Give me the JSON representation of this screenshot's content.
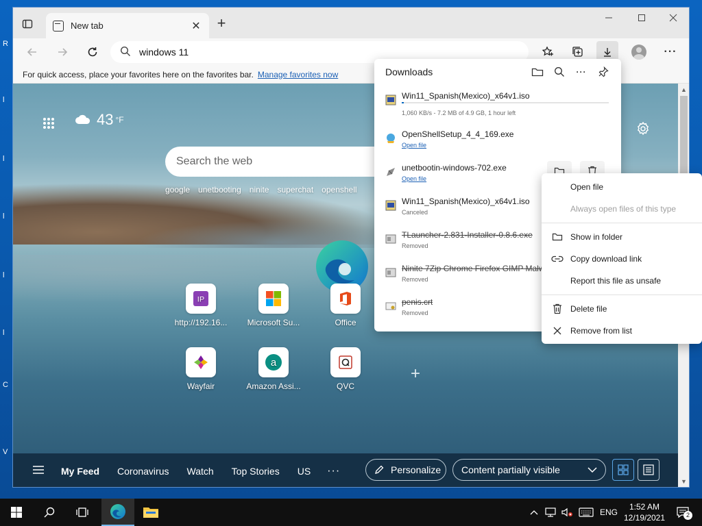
{
  "desktop": {
    "edge_letters": [
      "R",
      "l",
      "l",
      "l",
      "l",
      "l",
      "C",
      "V"
    ]
  },
  "browser": {
    "tab": {
      "title": "New tab"
    },
    "address": {
      "value": "windows 11"
    },
    "favorites_bar": {
      "text": "For quick access, place your favorites here on the favorites bar.",
      "link": "Manage favorites now"
    }
  },
  "newtab": {
    "weather": {
      "temp": "43",
      "unit": "°F"
    },
    "search": {
      "placeholder": "Search the web"
    },
    "suggestions": [
      "google",
      "unetbooting",
      "ninite",
      "superchat",
      "openshell"
    ],
    "tiles": [
      {
        "label": "http://192.16...",
        "icon": "ip-icon"
      },
      {
        "label": "Microsoft Su...",
        "icon": "microsoft-icon"
      },
      {
        "label": "Office",
        "icon": "office-icon"
      },
      {
        "label": "Wayfair",
        "icon": "wayfair-icon"
      },
      {
        "label": "Amazon Assi...",
        "icon": "amazon-icon"
      },
      {
        "label": "QVC",
        "icon": "qvc-icon"
      }
    ],
    "feed": {
      "tabs": [
        "My Feed",
        "Coronavirus",
        "Watch",
        "Top Stories",
        "US"
      ],
      "more": "···",
      "personalize": "Personalize",
      "visibility": "Content partially visible"
    }
  },
  "downloads": {
    "title": "Downloads",
    "items": [
      {
        "name": "Win11_Spanish(Mexico)_x64v1.iso",
        "status": "1,060 KB/s - 7.2 MB of 4.9 GB, 1 hour left",
        "progress": 0.0015
      },
      {
        "name": "OpenShellSetup_4_4_169.exe",
        "status": "Open file"
      },
      {
        "name": "unetbootin-windows-702.exe",
        "status": "Open file"
      },
      {
        "name": "Win11_Spanish(Mexico)_x64v1.iso",
        "status": "Canceled"
      },
      {
        "name": "TLauncher-2.831-Installer-0.8.6.exe",
        "status": "Removed"
      },
      {
        "name": "Ninite 7Zip Chrome Firefox GIMP Malw",
        "status": "Removed"
      },
      {
        "name": "penis.crt",
        "status": "Removed"
      }
    ]
  },
  "context_menu": {
    "items": [
      {
        "label": "Open file"
      },
      {
        "label": "Always open files of this type"
      },
      {
        "label": "Show in folder"
      },
      {
        "label": "Copy download link"
      },
      {
        "label": "Report this file as unsafe"
      },
      {
        "label": "Delete file"
      },
      {
        "label": "Remove from list"
      }
    ]
  },
  "taskbar": {
    "language": "ENG",
    "time": "1:52 AM",
    "date": "12/19/2021",
    "notifications": "2"
  }
}
